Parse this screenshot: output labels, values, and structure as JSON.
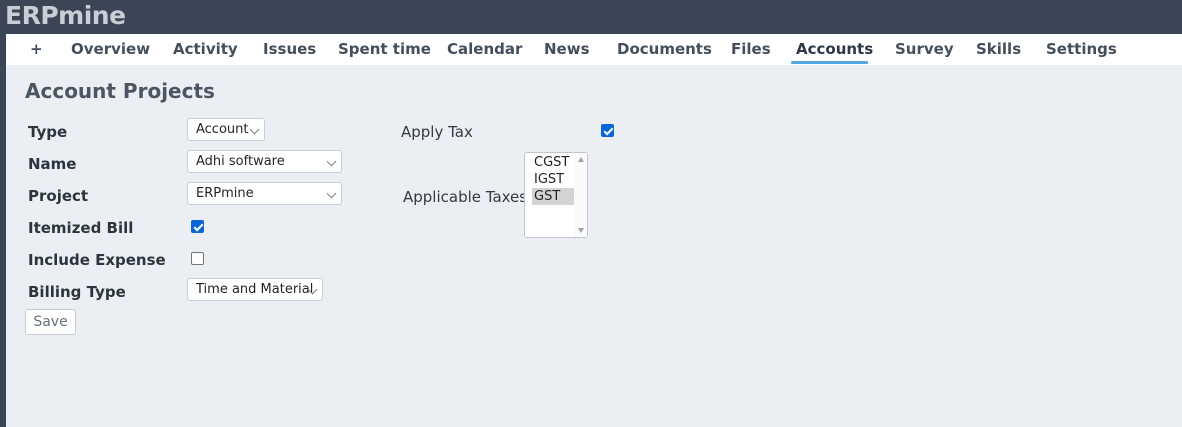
{
  "app": {
    "title": "ERPmine"
  },
  "menu": {
    "tabs": [
      {
        "label": "+"
      },
      {
        "label": "Overview"
      },
      {
        "label": "Activity"
      },
      {
        "label": "Issues"
      },
      {
        "label": "Spent time"
      },
      {
        "label": "Calendar"
      },
      {
        "label": "News"
      },
      {
        "label": "Documents"
      },
      {
        "label": "Files"
      },
      {
        "label": "Accounts",
        "selected": true
      },
      {
        "label": "Survey"
      },
      {
        "label": "Skills"
      },
      {
        "label": "Settings"
      }
    ],
    "accent_color": "#53a8e2"
  },
  "page": {
    "title": "Account Projects"
  },
  "form": {
    "type": {
      "label": "Type",
      "value": "Account"
    },
    "name": {
      "label": "Name",
      "value": "Adhi software"
    },
    "project": {
      "label": "Project",
      "value": "ERPmine"
    },
    "itemized_bill": {
      "label": "Itemized Bill",
      "checked": true
    },
    "include_expense": {
      "label": "Include Expense",
      "checked": false
    },
    "billing_type": {
      "label": "Billing Type",
      "value": "Time and Material"
    },
    "apply_tax": {
      "label": "Apply Tax",
      "checked": true
    },
    "applicable_taxes": {
      "label": "Applicable Taxes",
      "options": [
        "CGST",
        "IGST",
        "GST"
      ],
      "selected": "GST"
    },
    "save_label": "Save"
  },
  "icons": {
    "select": "chevron-down-icon",
    "listbox_up": "scroll-up-arrow-icon",
    "listbox_down": "scroll-down-arrow-icon"
  }
}
